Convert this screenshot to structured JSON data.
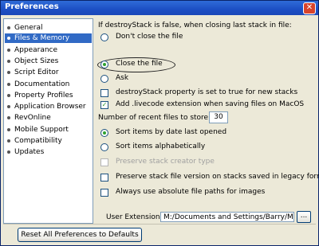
{
  "window": {
    "title": "Preferences",
    "close_glyph": "✕"
  },
  "sidebar": {
    "items": [
      {
        "label": "General",
        "selected": false
      },
      {
        "label": "Files & Memory",
        "selected": true
      },
      {
        "label": "Appearance",
        "selected": false
      },
      {
        "label": "Object Sizes",
        "selected": false
      },
      {
        "label": "Script Editor",
        "selected": false
      },
      {
        "label": "Documentation",
        "selected": false
      },
      {
        "label": "Property Profiles",
        "selected": false
      },
      {
        "label": "Application Browser",
        "selected": false
      },
      {
        "label": "RevOnline",
        "selected": false
      },
      {
        "label": "Mobile Support",
        "selected": false
      },
      {
        "label": "Compatibility",
        "selected": false
      },
      {
        "label": "Updates",
        "selected": false
      }
    ]
  },
  "main": {
    "heading": "If destroyStack is false, when closing last stack in file:",
    "close_options": [
      {
        "label": "Don't close the file",
        "checked": false
      },
      {
        "label": "Close the file",
        "checked": true
      },
      {
        "label": "Ask",
        "checked": false
      }
    ],
    "destroystack_check": {
      "label": "destroyStack property is set to true for new stacks",
      "checked": false
    },
    "livecode_ext_check": {
      "label": "Add .livecode extension when saving files on MacOS",
      "checked": true,
      "mark": "✓"
    },
    "recent_files": {
      "label": "Number of recent files to store:",
      "value": "30"
    },
    "sort_options": [
      {
        "label": "Sort items by date last opened",
        "checked": true
      },
      {
        "label": "Sort items alphabetically",
        "checked": false
      }
    ],
    "preserve_creator_check": {
      "label": "Preserve stack creator type",
      "checked": false,
      "disabled": true
    },
    "preserve_version_check": {
      "label": "Preserve stack file version on stacks saved in legacy format",
      "checked": false
    },
    "absolute_paths_check": {
      "label": "Always use absolute file paths for images",
      "checked": false
    },
    "user_extensions": {
      "label": "User Extensions:",
      "value": "M:/Documents and Settings/Barry/My Documen",
      "browse_label": "..."
    }
  },
  "footer": {
    "reset_label": "Reset All Preferences to Defaults"
  },
  "colors": {
    "selection": "#316ac5",
    "titlebar": "#1c4fc4",
    "check_green": "#2fa12f",
    "window_bg": "#ece9d8"
  }
}
